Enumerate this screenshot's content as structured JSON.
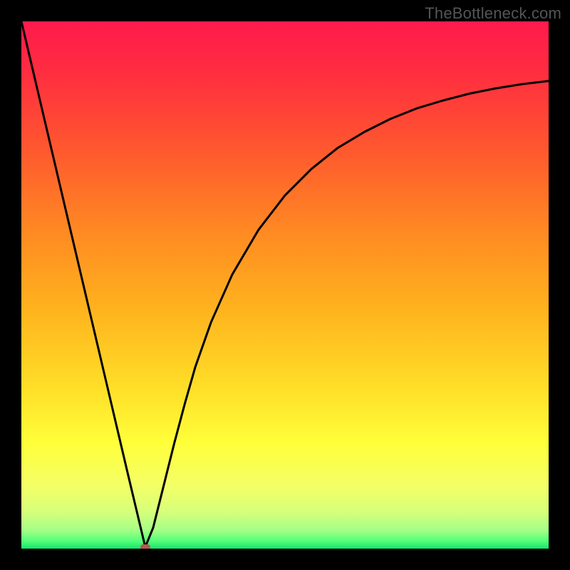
{
  "watermark": "TheBottleneck.com",
  "colors": {
    "frame": "#000000",
    "curve": "#000000",
    "marker": "#b6594e"
  },
  "gradient_stops": [
    {
      "pct": 0,
      "color": "#ff1a4d"
    },
    {
      "pct": 10,
      "color": "#ff2e3f"
    },
    {
      "pct": 25,
      "color": "#ff5a2e"
    },
    {
      "pct": 40,
      "color": "#ff8a22"
    },
    {
      "pct": 55,
      "color": "#ffb41e"
    },
    {
      "pct": 70,
      "color": "#ffe028"
    },
    {
      "pct": 80,
      "color": "#ffff3a"
    },
    {
      "pct": 88,
      "color": "#f4ff66"
    },
    {
      "pct": 93,
      "color": "#d6ff7a"
    },
    {
      "pct": 96.5,
      "color": "#a5ff86"
    },
    {
      "pct": 98.5,
      "color": "#55ff79"
    },
    {
      "pct": 100,
      "color": "#15e56b"
    }
  ],
  "chart_data": {
    "type": "line",
    "title": "",
    "xlabel": "",
    "ylabel": "",
    "xlim": [
      0,
      100
    ],
    "ylim": [
      0,
      100
    ],
    "annotations": [
      {
        "text": "TheBottleneck.com",
        "role": "watermark",
        "pos": "top-right"
      }
    ],
    "series": [
      {
        "name": "bottleneck-curve",
        "x": [
          0,
          2,
          4,
          6,
          8,
          10,
          12,
          14,
          16,
          18,
          20,
          22,
          23.5,
          25,
          27,
          29,
          31,
          33,
          36,
          40,
          45,
          50,
          55,
          60,
          65,
          70,
          75,
          80,
          85,
          90,
          95,
          100
        ],
        "y": [
          100,
          91.5,
          83,
          74.5,
          66,
          57.5,
          49,
          40.5,
          32,
          23.5,
          15,
          6.6,
          0.3,
          4,
          12,
          20,
          27.5,
          34.5,
          43,
          52,
          60.5,
          67,
          72,
          76,
          79,
          81.5,
          83.5,
          85,
          86.3,
          87.3,
          88.1,
          88.7
        ]
      }
    ],
    "marker": {
      "x": 23.5,
      "y": 0.3,
      "color": "#b6594e"
    },
    "legend": []
  }
}
